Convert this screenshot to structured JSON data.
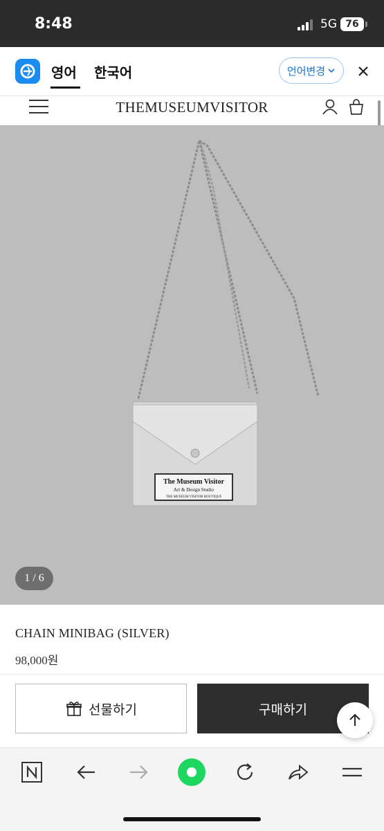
{
  "status_bar": {
    "time": "8:48",
    "network": "5G",
    "battery": "76"
  },
  "translate_bar": {
    "tab_english": "영어",
    "tab_korean": "한국어",
    "change_language_label": "언어변경"
  },
  "site_header": {
    "title": "THEMUSEUMVISITOR"
  },
  "product": {
    "image_counter": "1 / 6",
    "tag_line1": "The Museum Visitor",
    "tag_line2": "Art & Design Studio",
    "tag_line3": "THE MUSEUM VISITOR BOUTIQUE",
    "name": "CHAIN MINIBAG (SILVER)",
    "price": "98,000원"
  },
  "actions": {
    "gift_label": "선물하기",
    "buy_label": "구매하기"
  },
  "colors": {
    "accent_blue": "#1a8cf0",
    "buy_button": "#2e2e2e",
    "image_background": "#bdbdbd",
    "browser_center": "#1ed760"
  }
}
